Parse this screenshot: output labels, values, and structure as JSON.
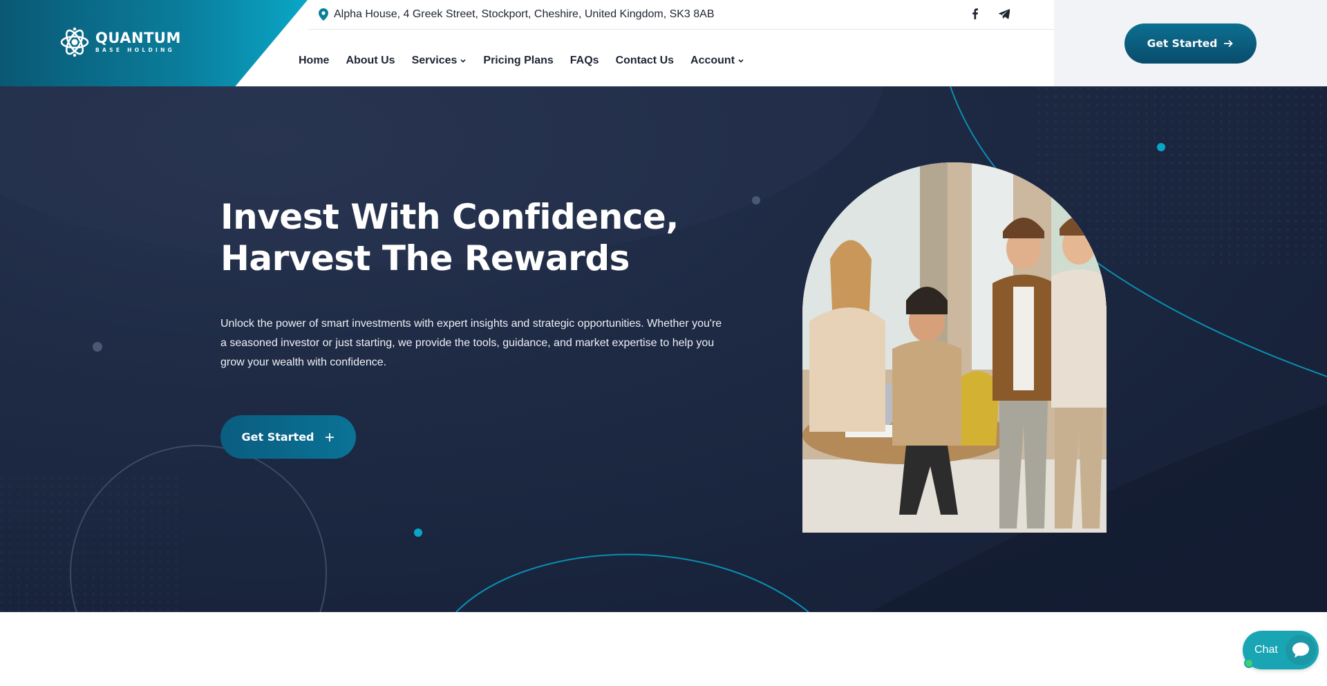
{
  "header": {
    "logo": {
      "name": "QUANTUM",
      "tagline": "BASE HOLDING"
    },
    "address": "Alpha House, 4 Greek Street, Stockport, Cheshire, United Kingdom, SK3 8AB",
    "socials": [
      {
        "icon": "facebook-icon"
      },
      {
        "icon": "telegram-icon"
      }
    ],
    "nav": [
      {
        "label": "Home",
        "dropdown": false
      },
      {
        "label": "About Us",
        "dropdown": false
      },
      {
        "label": "Services",
        "dropdown": true
      },
      {
        "label": "Pricing Plans",
        "dropdown": false
      },
      {
        "label": "FAQs",
        "dropdown": false
      },
      {
        "label": "Contact Us",
        "dropdown": false
      },
      {
        "label": "Account",
        "dropdown": true
      }
    ],
    "cta_label": "Get Started"
  },
  "hero": {
    "title_line1": "Invest With Confidence,",
    "title_line2": "Harvest The Rewards",
    "description": "Unlock the power of smart investments with expert insights and strategic opportunities. Whether you're a seasoned investor or just starting, we provide the tools, guidance, and market expertise to help you grow your wealth with confidence.",
    "cta_label": "Get Started",
    "image_subject": "team-meeting-photo"
  },
  "chat": {
    "label": "Chat"
  },
  "colors": {
    "brand_primary": "#0a5d80",
    "brand_accent": "#0aa6c6",
    "hero_background": "#1e2a44",
    "chat_background": "#1aa5b5",
    "online_indicator": "#3fd16a"
  }
}
